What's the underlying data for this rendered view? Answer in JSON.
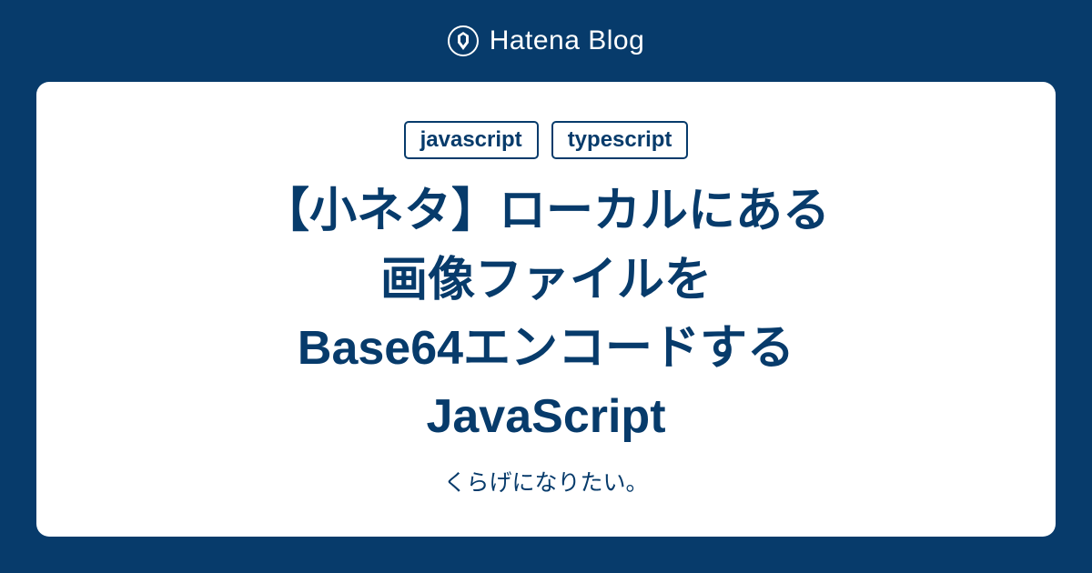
{
  "header": {
    "brand": "Hatena Blog"
  },
  "card": {
    "tags": [
      "javascript",
      "typescript"
    ],
    "title": "【小ネタ】ローカルにある\n画像ファイルを\nBase64エンコードする\nJavaScript",
    "subtitle": "くらげになりたい。"
  }
}
